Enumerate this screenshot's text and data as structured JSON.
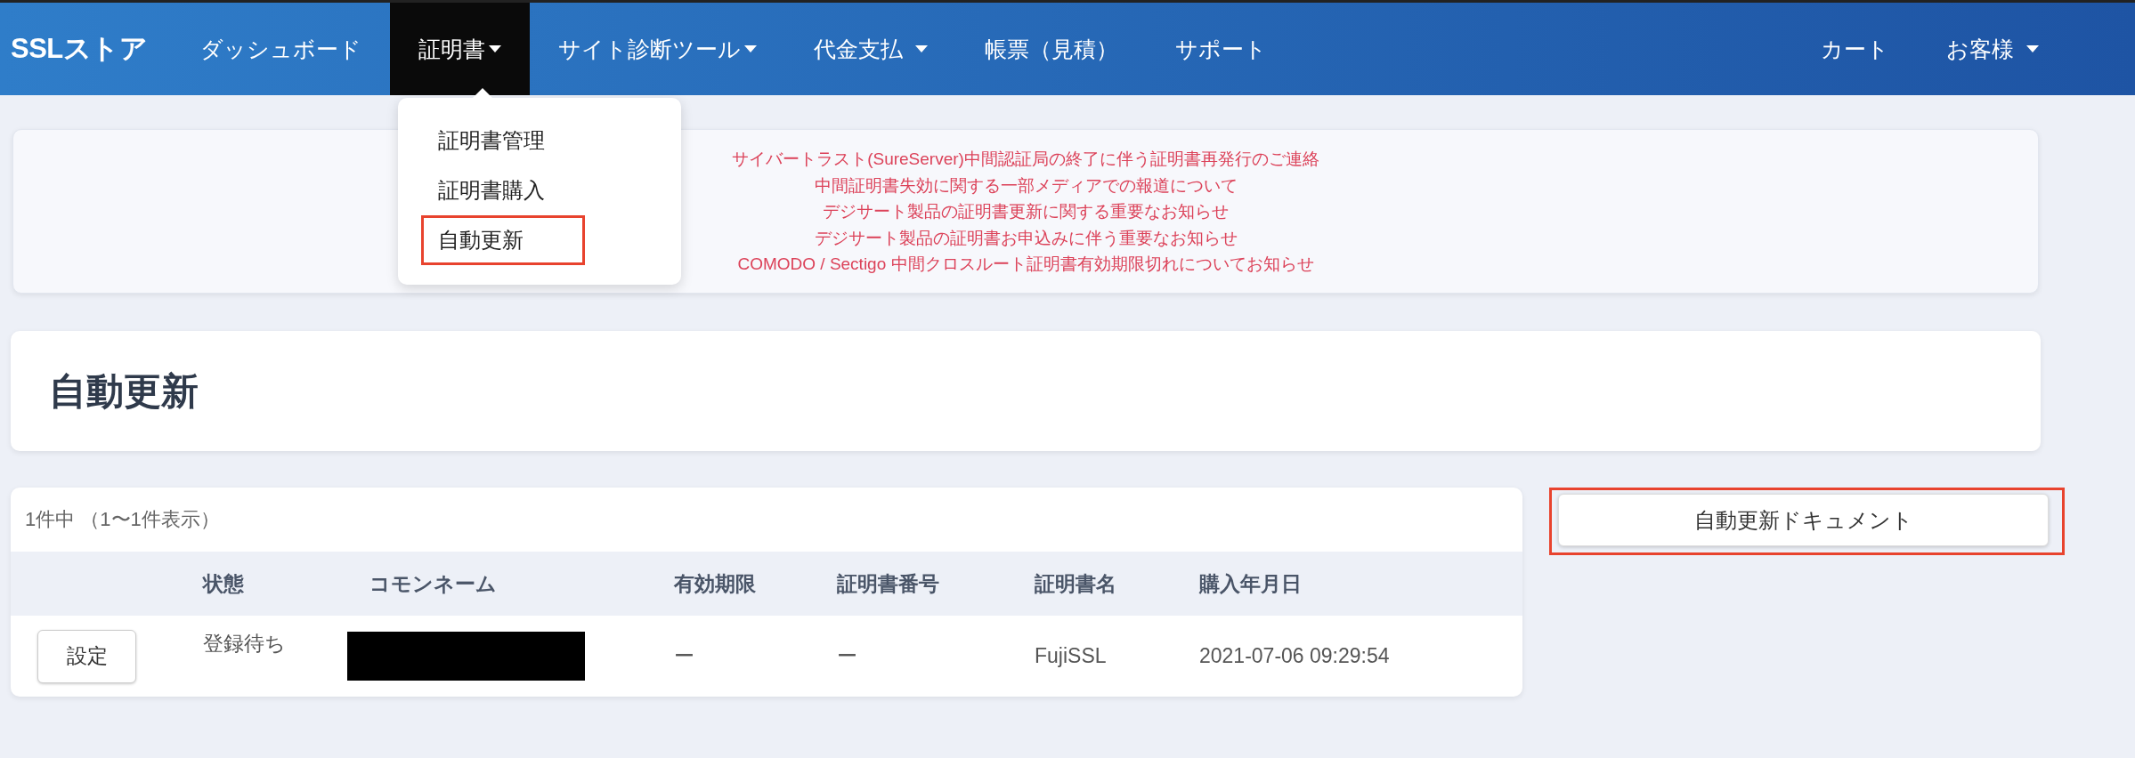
{
  "nav": {
    "logo": "SSLストア",
    "items": [
      {
        "label": "ダッシュボード",
        "caret": false,
        "selected": false
      },
      {
        "label": "証明書",
        "caret": true,
        "selected": true
      },
      {
        "label": "サイト診断ツール",
        "caret": true,
        "selected": false
      },
      {
        "label": "代金支払",
        "caret": true,
        "selected": false
      },
      {
        "label": "帳票（見積）",
        "caret": false,
        "selected": false
      },
      {
        "label": "サポート",
        "caret": false,
        "selected": false
      }
    ],
    "right_items": [
      {
        "label": "カート",
        "caret": false
      },
      {
        "label": "お客様",
        "caret": true
      }
    ]
  },
  "dropdown": {
    "items": [
      {
        "label": "証明書管理",
        "highlighted": false
      },
      {
        "label": "証明書購入",
        "highlighted": false
      },
      {
        "label": "自動更新",
        "highlighted": true
      }
    ]
  },
  "notices": [
    "サイバートラスト(SureServer)中間認証局の終了に伴う証明書再発行のご連絡",
    "中間証明書失効に関する一部メディアでの報道について",
    "デジサート製品の証明書更新に関する重要なお知らせ",
    "デジサート製品の証明書お申込みに伴う重要なお知らせ",
    "COMODO / Sectigo 中間クロスルート証明書有効期限切れについてお知らせ"
  ],
  "page_title": "自動更新",
  "table": {
    "summary": "1件中 （1〜1件表示）",
    "columns": [
      "状態",
      "コモンネーム",
      "有効期限",
      "証明書番号",
      "証明書名",
      "購入年月日"
    ],
    "rows": [
      {
        "action": "設定",
        "status": "登録待ち",
        "common_name_redacted": true,
        "expiry": "ー",
        "cert_number": "ー",
        "cert_name": "FujiSSL",
        "purchased": "2021-07-06 09:29:54"
      }
    ]
  },
  "document_button": {
    "label": "自動更新ドキュメント",
    "highlighted": true
  }
}
